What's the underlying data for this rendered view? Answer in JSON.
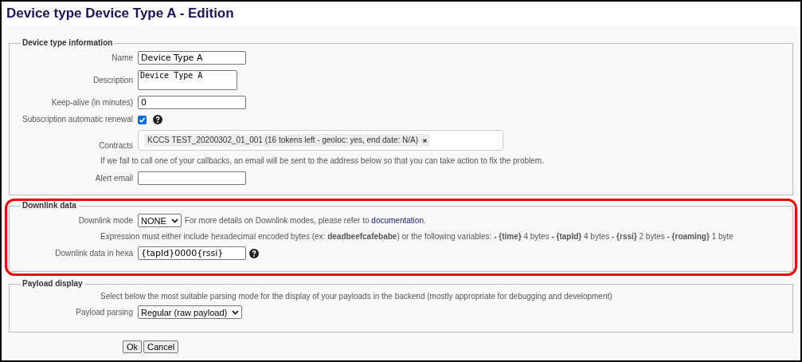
{
  "page_title": "Device type Device Type A - Edition",
  "sections": [
    {
      "legend": "Device type information",
      "highlighted": false,
      "rows": [
        {
          "kind": "text",
          "label": "Name",
          "value": "Device Type A"
        },
        {
          "kind": "textarea",
          "label": "Description",
          "value": "Device Type A"
        },
        {
          "kind": "text",
          "label": "Keep-alive (in minutes)",
          "value": "0"
        },
        {
          "kind": "checkbox",
          "label": "Subscription automatic renewal",
          "checked": true,
          "help": true
        },
        {
          "kind": "tags",
          "label": "Contracts",
          "tags": [
            "KCCS TEST_20200302_01_001 (16 tokens left - geoloc: yes, end date: N/A)"
          ]
        },
        {
          "kind": "note",
          "text": "If we fail to call one of your callbacks, an email will be sent to the address below so that you can take action to fix the problem."
        },
        {
          "kind": "text",
          "label": "Alert email",
          "value": ""
        }
      ]
    },
    {
      "legend": "Downlink data",
      "highlighted": true,
      "rows": [
        {
          "kind": "select",
          "label": "Downlink mode",
          "value": "NONE",
          "note": "For more details on Downlink modes, please refer to",
          "link": "documentation",
          "after": "."
        },
        {
          "kind": "note",
          "text": "Expression must either include hexadecimal encoded bytes (ex: **deadbeefcafebabe**) or the following variables: **- {time}** 4 bytes **- {tapId}** 4 bytes **- {rssi}** 2 bytes **- {roaming}** 1 byte"
        },
        {
          "kind": "text",
          "label": "Downlink data in hexa",
          "value": "{tapId}0000{rssi}",
          "help": true
        }
      ]
    },
    {
      "legend": "Payload display",
      "highlighted": false,
      "rows": [
        {
          "kind": "note",
          "text": "Select below the most suitable parsing mode for the display of your payloads in the backend (mostly appropriate for debugging and development)"
        },
        {
          "kind": "select",
          "label": "Payload parsing",
          "value": "Regular (raw payload)"
        }
      ]
    }
  ],
  "buttons": [
    "Ok",
    "Cancel"
  ]
}
